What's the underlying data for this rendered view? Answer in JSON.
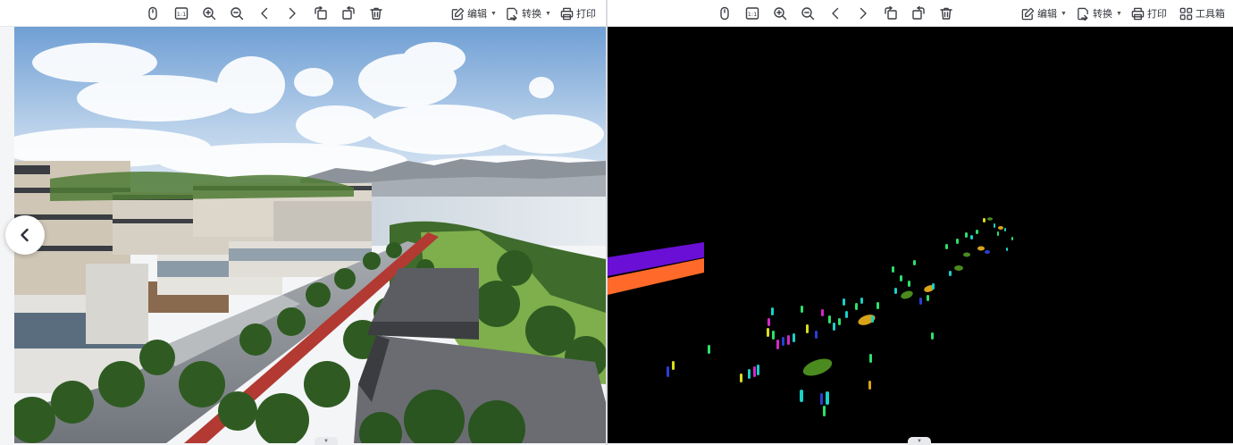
{
  "left_panel": {
    "toolbar": {
      "edit_label": "编辑",
      "convert_label": "转换",
      "print_label": "打印"
    },
    "actual_size_label": "1:1",
    "icons": [
      "mouse-icon",
      "actual-size-icon",
      "zoom-in-icon",
      "zoom-out-icon",
      "chevron-left-icon",
      "chevron-right-icon",
      "rotate-left-icon",
      "rotate-right-icon",
      "trash-icon"
    ],
    "image": "architectural rendering of terrace houses along a tree lined street with a red bike lane, lake and mountains in background"
  },
  "right_panel": {
    "toolbar": {
      "edit_label": "编辑",
      "convert_label": "转换",
      "print_label": "打印",
      "toolbox_label": "工具箱"
    },
    "actual_size_label": "1:1",
    "image": "semantic segmentation mask on black background: pedestrians, cars and two stripe regions",
    "mask_colors": {
      "background": "#000000",
      "stripe_purple": "#6a0fd6",
      "stripe_orange": "#ff6a2a",
      "car_green": "#4b8a1e",
      "car_yellow": "#d8a319",
      "person_cyan": "#19d0c8",
      "person_green": "#2ee06a",
      "person_magenta": "#d129c9",
      "person_blue": "#2b3fd4"
    }
  },
  "colors": {
    "toolbar_bg": "#ffffff",
    "icon_stroke": "#3c3f45",
    "page_bg": "#f4f5f7"
  }
}
